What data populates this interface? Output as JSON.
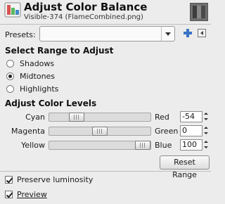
{
  "header": {
    "title": "Adjust Color Balance",
    "subtitle": "Visible-374 (FlameCombined.png)",
    "icon": "color-balance-icon"
  },
  "presets": {
    "label": "Presets:",
    "value": ""
  },
  "range": {
    "heading": "Select Range to Adjust",
    "options": [
      "Shadows",
      "Midtones",
      "Highlights"
    ],
    "selected": "Midtones"
  },
  "levels": {
    "heading": "Adjust Color Levels",
    "rows": [
      {
        "left": "Cyan",
        "right": "Red",
        "value": "-54",
        "level": -54
      },
      {
        "left": "Magenta",
        "right": "Green",
        "value": "0",
        "level": 0
      },
      {
        "left": "Yellow",
        "right": "Blue",
        "value": "100",
        "level": 100
      }
    ],
    "range_min": -100,
    "range_max": 100
  },
  "buttons": {
    "reset": "Reset Range"
  },
  "options": {
    "preserve_luminosity": {
      "label": "Preserve luminosity",
      "checked": true
    },
    "preview": {
      "label": "Preview",
      "checked": true
    }
  },
  "colors": {
    "plus_icon": "#3a73c6",
    "section_text": "#111111"
  }
}
